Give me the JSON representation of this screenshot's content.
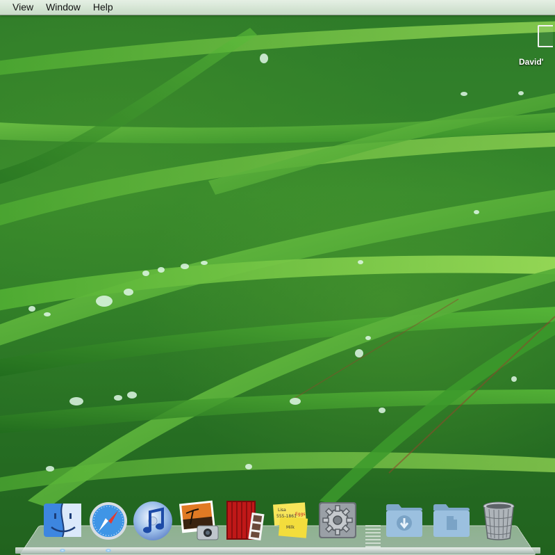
{
  "menubar": {
    "items": [
      "View",
      "Window",
      "Help"
    ]
  },
  "desktop": {
    "drive_label": "David'"
  },
  "dock": {
    "apps": [
      {
        "name": "Finder",
        "icon": "finder-icon",
        "running": true
      },
      {
        "name": "Safari",
        "icon": "safari-icon",
        "running": true
      },
      {
        "name": "iTunes",
        "icon": "itunes-icon",
        "running": false
      },
      {
        "name": "iPhoto",
        "icon": "iphoto-icon",
        "running": false
      },
      {
        "name": "Photo Booth",
        "icon": "photo-booth-icon",
        "running": false
      },
      {
        "name": "Stickies",
        "icon": "stickies-icon",
        "running": false
      },
      {
        "name": "System Preferences",
        "icon": "system-preferences-icon",
        "running": false
      },
      {
        "name": "Downloads",
        "icon": "downloads-folder-icon",
        "running": false
      },
      {
        "name": "Documents",
        "icon": "documents-folder-icon",
        "running": false
      },
      {
        "name": "Trash",
        "icon": "trash-icon",
        "running": false
      }
    ],
    "sticky_note": {
      "line1": "Lisa",
      "line2": "555-1861",
      "line3": "Eggs",
      "line4": "Milk"
    }
  },
  "colors": {
    "wallpaper_green": "#2f7d2a",
    "menubar_bg": "#eef5ee",
    "sticky_yellow": "#f7e55a"
  }
}
